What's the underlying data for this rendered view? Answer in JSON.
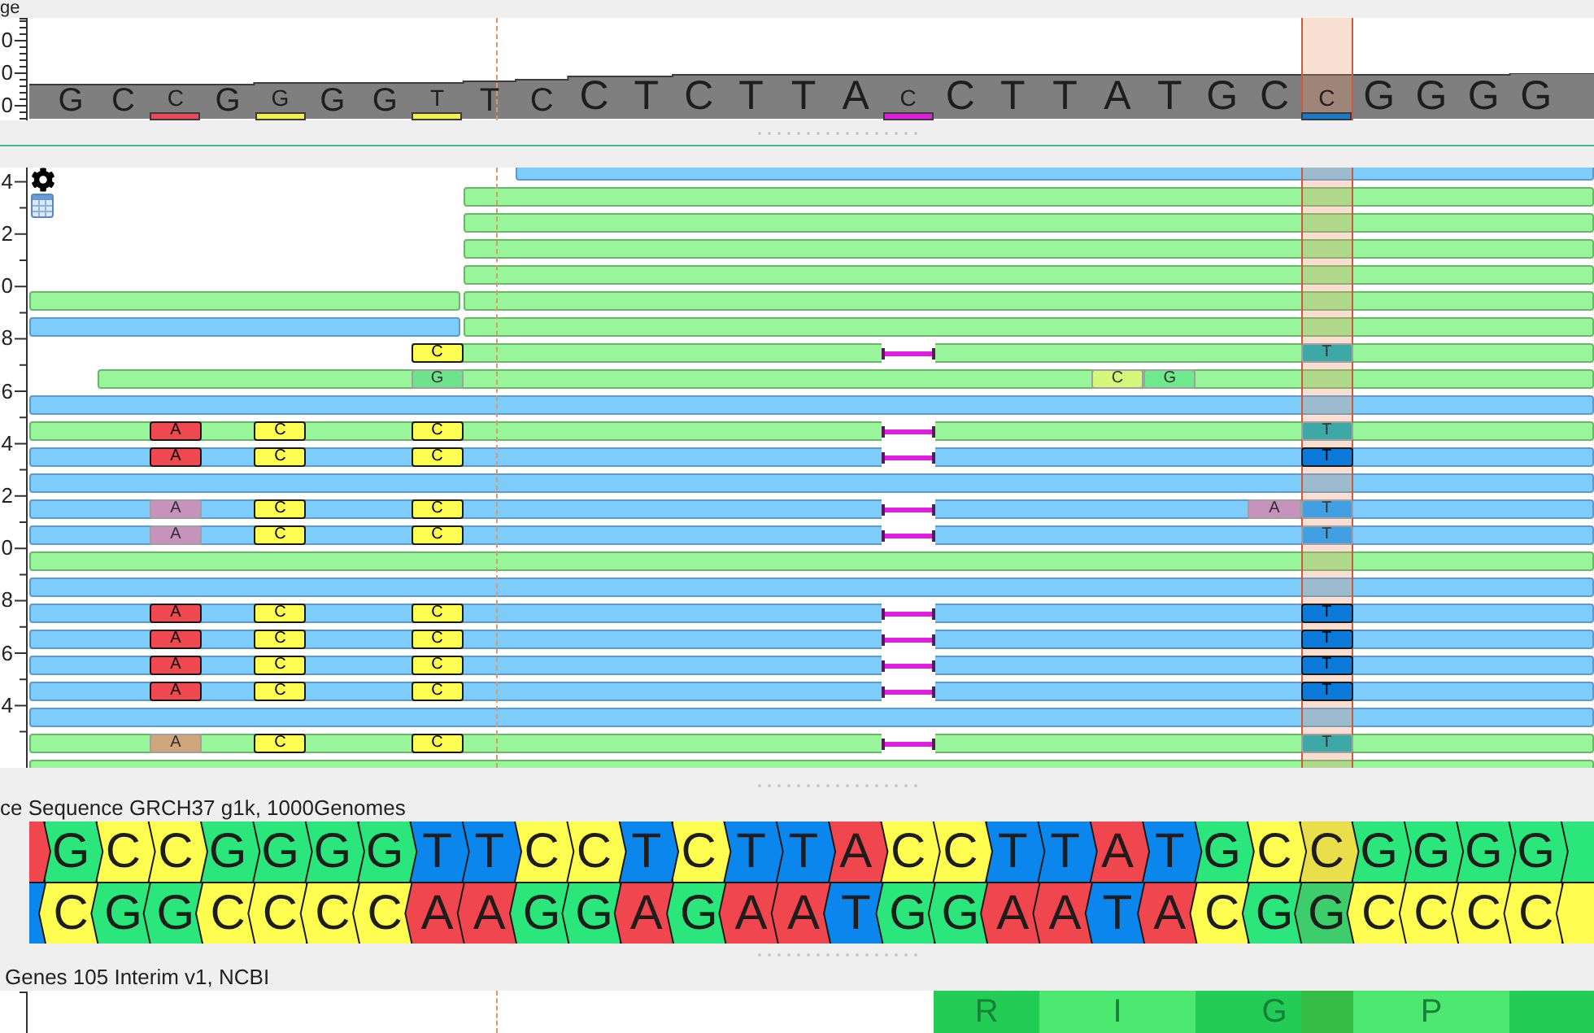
{
  "coverage_track": {
    "title": "ge",
    "axis_labels": [
      "0",
      "0",
      "0"
    ],
    "bases": [
      {
        "base": "G"
      },
      {
        "base": "C"
      },
      {
        "base": "C",
        "color": "#ea4a57"
      },
      {
        "base": "G"
      },
      {
        "base": "G",
        "color": "#f3ef4f"
      },
      {
        "base": "G"
      },
      {
        "base": "G"
      },
      {
        "base": "T",
        "color": "#f3ef4f"
      },
      {
        "base": "T"
      },
      {
        "base": "C"
      },
      {
        "base": "C"
      },
      {
        "base": "T"
      },
      {
        "base": "C"
      },
      {
        "base": "T"
      },
      {
        "base": "T"
      },
      {
        "base": "A"
      },
      {
        "base": "C",
        "color": "#e01ee0"
      },
      {
        "base": "C"
      },
      {
        "base": "T"
      },
      {
        "base": "T"
      },
      {
        "base": "A"
      },
      {
        "base": "T"
      },
      {
        "base": "G"
      },
      {
        "base": "C"
      },
      {
        "base": "C",
        "color": "#1a7acc"
      },
      {
        "base": "G"
      },
      {
        "base": "G"
      },
      {
        "base": "G"
      },
      {
        "base": "G"
      }
    ]
  },
  "reads_track": {
    "axis_labels": [
      "4",
      "2",
      "0",
      "8",
      "6",
      "4",
      "2",
      "0",
      "8",
      "6",
      "4"
    ],
    "reads": [
      {
        "kind": "reverse",
        "deletion": false
      },
      {
        "kind": "forward",
        "deletion": false
      },
      {
        "kind": "forward",
        "deletion": false
      },
      {
        "kind": "forward",
        "deletion": false
      },
      {
        "kind": "forward",
        "deletion": false
      },
      {
        "kind": "forward",
        "deletion": false
      },
      {
        "kind": "forward",
        "deletion": false
      },
      {
        "kind": "reverse",
        "deletion": false
      },
      {
        "kind": "forward",
        "deletion": false
      },
      {
        "kind": "forward",
        "deletion": true,
        "mismatches": [
          {
            "base": "C",
            "color": "#fdfd52",
            "low_quality": false
          },
          {
            "base": "T",
            "color": "#3ea8a6",
            "low_quality": true
          }
        ]
      },
      {
        "kind": "forward",
        "deletion": false,
        "mismatches": [
          {
            "base": "G",
            "color": "#6ee38d",
            "low_quality": true
          },
          {
            "base": "C",
            "color": "#d5f77b",
            "low_quality": true
          },
          {
            "base": "G",
            "color": "#6ee98b",
            "low_quality": true
          }
        ]
      },
      {
        "kind": "reverse",
        "deletion": false
      },
      {
        "kind": "forward",
        "deletion": true,
        "mismatches": [
          {
            "base": "A",
            "color": "#f04850",
            "low_quality": false
          },
          {
            "base": "C",
            "color": "#fdfd52",
            "low_quality": false
          },
          {
            "base": "C",
            "color": "#fdfd52",
            "low_quality": false
          },
          {
            "base": "T",
            "color": "#3ea8a6",
            "low_quality": true
          }
        ]
      },
      {
        "kind": "reverse",
        "deletion": true,
        "mismatches": [
          {
            "base": "A",
            "color": "#f04850",
            "low_quality": false
          },
          {
            "base": "C",
            "color": "#fdfd52",
            "low_quality": false
          },
          {
            "base": "C",
            "color": "#fdfd52",
            "low_quality": false
          },
          {
            "base": "T",
            "color": "#0b7ad8",
            "low_quality": false
          }
        ]
      },
      {
        "kind": "reverse",
        "deletion": false
      },
      {
        "kind": "reverse",
        "deletion": true,
        "mismatches": [
          {
            "base": "A",
            "color": "#c792bc",
            "low_quality": true
          },
          {
            "base": "C",
            "color": "#fdfd52",
            "low_quality": false
          },
          {
            "base": "C",
            "color": "#fdfd52",
            "low_quality": false
          },
          {
            "base": "A",
            "color": "#c792bc",
            "low_quality": true
          },
          {
            "base": "T",
            "color": "#42a0e2",
            "low_quality": true
          }
        ]
      },
      {
        "kind": "reverse",
        "deletion": true,
        "mismatches": [
          {
            "base": "A",
            "color": "#c792bc",
            "low_quality": true
          },
          {
            "base": "C",
            "color": "#fdfd52",
            "low_quality": false
          },
          {
            "base": "C",
            "color": "#fdfd52",
            "low_quality": false
          },
          {
            "base": "T",
            "color": "#42a0e2",
            "low_quality": true
          }
        ]
      },
      {
        "kind": "forward",
        "deletion": false
      },
      {
        "kind": "reverse",
        "deletion": false
      },
      {
        "kind": "reverse",
        "deletion": true,
        "mismatches": [
          {
            "base": "A",
            "color": "#f04850",
            "low_quality": false
          },
          {
            "base": "C",
            "color": "#fdfd52",
            "low_quality": false
          },
          {
            "base": "C",
            "color": "#fdfd52",
            "low_quality": false
          },
          {
            "base": "T",
            "color": "#0b7ad8",
            "low_quality": false
          }
        ]
      },
      {
        "kind": "reverse",
        "deletion": true,
        "mismatches": [
          {
            "base": "A",
            "color": "#f04850",
            "low_quality": false
          },
          {
            "base": "C",
            "color": "#fdfd52",
            "low_quality": false
          },
          {
            "base": "C",
            "color": "#fdfd52",
            "low_quality": false
          },
          {
            "base": "T",
            "color": "#0b7ad8",
            "low_quality": false
          }
        ]
      },
      {
        "kind": "reverse",
        "deletion": true,
        "mismatches": [
          {
            "base": "A",
            "color": "#f04850",
            "low_quality": false
          },
          {
            "base": "C",
            "color": "#fdfd52",
            "low_quality": false
          },
          {
            "base": "C",
            "color": "#fdfd52",
            "low_quality": false
          },
          {
            "base": "T",
            "color": "#0b7ad8",
            "low_quality": false
          }
        ]
      },
      {
        "kind": "reverse",
        "deletion": true,
        "mismatches": [
          {
            "base": "A",
            "color": "#f04850",
            "low_quality": false
          },
          {
            "base": "C",
            "color": "#fdfd52",
            "low_quality": false
          },
          {
            "base": "C",
            "color": "#fdfd52",
            "low_quality": false
          },
          {
            "base": "T",
            "color": "#0b7ad8",
            "low_quality": false
          }
        ]
      },
      {
        "kind": "reverse",
        "deletion": false
      },
      {
        "kind": "forward",
        "deletion": true,
        "mismatches": [
          {
            "base": "A",
            "color": "#cfa57c",
            "low_quality": true
          },
          {
            "base": "C",
            "color": "#fdfd52",
            "low_quality": false
          },
          {
            "base": "C",
            "color": "#fdfd52",
            "low_quality": false
          },
          {
            "base": "T",
            "color": "#3ea8a6",
            "low_quality": true
          }
        ]
      },
      {
        "kind": "forward",
        "deletion": false
      }
    ]
  },
  "reference_track": {
    "title": "ce Sequence GRCH37 g1k, 1000Genomes",
    "columns": [
      {
        "top": {
          "color": "#f0474f"
        },
        "bottom": {
          "color": "#0a86ec"
        },
        "selected": false
      },
      {
        "top": {
          "base": "G",
          "color": "#2be67a"
        },
        "bottom": {
          "base": "C",
          "color": "#fffd50"
        },
        "selected": false
      },
      {
        "top": {
          "base": "C",
          "color": "#fffd50"
        },
        "bottom": {
          "base": "G",
          "color": "#2be67a"
        },
        "selected": false
      },
      {
        "top": {
          "base": "C",
          "color": "#fffd50"
        },
        "bottom": {
          "base": "G",
          "color": "#2be67a"
        },
        "selected": false
      },
      {
        "top": {
          "base": "G",
          "color": "#2be67a"
        },
        "bottom": {
          "base": "C",
          "color": "#fffd50"
        },
        "selected": false
      },
      {
        "top": {
          "base": "G",
          "color": "#2be67a"
        },
        "bottom": {
          "base": "C",
          "color": "#fffd50"
        },
        "selected": false
      },
      {
        "top": {
          "base": "G",
          "color": "#2be67a"
        },
        "bottom": {
          "base": "C",
          "color": "#fffd50"
        },
        "selected": false
      },
      {
        "top": {
          "base": "G",
          "color": "#2be67a"
        },
        "bottom": {
          "base": "C",
          "color": "#fffd50"
        },
        "selected": false
      },
      {
        "top": {
          "base": "T",
          "color": "#0a86ec"
        },
        "bottom": {
          "base": "A",
          "color": "#f0474f"
        },
        "selected": false
      },
      {
        "top": {
          "base": "T",
          "color": "#0a86ec"
        },
        "bottom": {
          "base": "A",
          "color": "#f0474f"
        },
        "selected": false
      },
      {
        "top": {
          "base": "C",
          "color": "#fffd50"
        },
        "bottom": {
          "base": "G",
          "color": "#2be67a"
        },
        "selected": false
      },
      {
        "top": {
          "base": "C",
          "color": "#fffd50"
        },
        "bottom": {
          "base": "G",
          "color": "#2be67a"
        },
        "selected": false
      },
      {
        "top": {
          "base": "T",
          "color": "#0a86ec"
        },
        "bottom": {
          "base": "A",
          "color": "#f0474f"
        },
        "selected": false
      },
      {
        "top": {
          "base": "C",
          "color": "#fffd50"
        },
        "bottom": {
          "base": "G",
          "color": "#2be67a"
        },
        "selected": false
      },
      {
        "top": {
          "base": "T",
          "color": "#0a86ec"
        },
        "bottom": {
          "base": "A",
          "color": "#f0474f"
        },
        "selected": false
      },
      {
        "top": {
          "base": "T",
          "color": "#0a86ec"
        },
        "bottom": {
          "base": "A",
          "color": "#f0474f"
        },
        "selected": false
      },
      {
        "top": {
          "base": "A",
          "color": "#f0474f"
        },
        "bottom": {
          "base": "T",
          "color": "#0a86ec"
        },
        "selected": false
      },
      {
        "top": {
          "base": "C",
          "color": "#fffd50"
        },
        "bottom": {
          "base": "G",
          "color": "#2be67a"
        },
        "selected": false
      },
      {
        "top": {
          "base": "C",
          "color": "#fffd50"
        },
        "bottom": {
          "base": "G",
          "color": "#2be67a"
        },
        "selected": false
      },
      {
        "top": {
          "base": "T",
          "color": "#0a86ec"
        },
        "bottom": {
          "base": "A",
          "color": "#f0474f"
        },
        "selected": false
      },
      {
        "top": {
          "base": "T",
          "color": "#0a86ec"
        },
        "bottom": {
          "base": "A",
          "color": "#f0474f"
        },
        "selected": false
      },
      {
        "top": {
          "base": "A",
          "color": "#f0474f"
        },
        "bottom": {
          "base": "T",
          "color": "#0a86ec"
        },
        "selected": false
      },
      {
        "top": {
          "base": "T",
          "color": "#0a86ec"
        },
        "bottom": {
          "base": "A",
          "color": "#f0474f"
        },
        "selected": false
      },
      {
        "top": {
          "base": "G",
          "color": "#2be67a"
        },
        "bottom": {
          "base": "C",
          "color": "#fffd50"
        },
        "selected": false
      },
      {
        "top": {
          "base": "C",
          "color": "#fffd50"
        },
        "bottom": {
          "base": "G",
          "color": "#2be67a"
        },
        "selected": false
      },
      {
        "top": {
          "base": "C",
          "color": "#fffd50"
        },
        "bottom": {
          "base": "G",
          "color": "#2be67a"
        },
        "selected": true
      },
      {
        "top": {
          "base": "G",
          "color": "#2be67a"
        },
        "bottom": {
          "base": "C",
          "color": "#fffd50"
        },
        "selected": false
      },
      {
        "top": {
          "base": "G",
          "color": "#2be67a"
        },
        "bottom": {
          "base": "C",
          "color": "#fffd50"
        },
        "selected": false
      },
      {
        "top": {
          "base": "G",
          "color": "#2be67a"
        },
        "bottom": {
          "base": "C",
          "color": "#fffd50"
        },
        "selected": false
      },
      {
        "top": {
          "base": "G",
          "color": "#2be67a"
        },
        "bottom": {
          "base": "C",
          "color": "#fffd50"
        },
        "selected": false
      },
      {
        "top": {
          "color": "#2be67a"
        },
        "bottom": {
          "color": "#fffd50"
        },
        "selected": false
      }
    ]
  },
  "genes_track": {
    "title": "Genes 105 Interim v1, NCBI",
    "codons": [
      {
        "amino_acid": "R",
        "color": "#22cc55"
      },
      {
        "amino_acid": "I",
        "color": "#4de870"
      },
      {
        "amino_acid": "G",
        "color": "#22cc55"
      },
      {
        "amino_acid": "P",
        "color": "#4de870"
      },
      {
        "color": "#22cc55"
      }
    ]
  }
}
